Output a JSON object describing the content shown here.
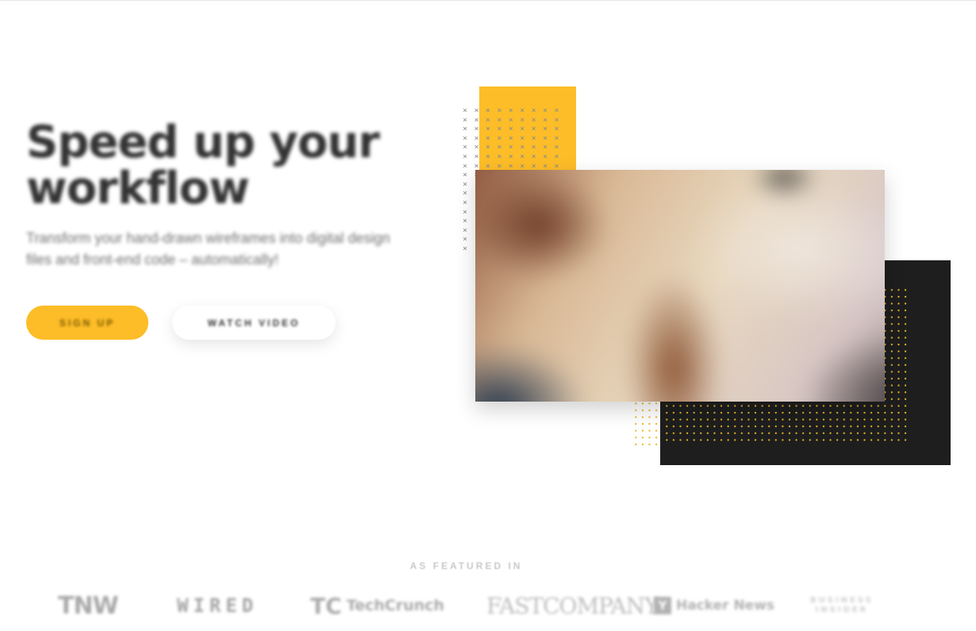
{
  "hero": {
    "headline": "Speed up your workflow",
    "subtitle": "Transform your hand-drawn wireframes into digital design files and front-end code – automatically!",
    "primary_cta": "SIGN UP",
    "secondary_cta": "WATCH VIDEO"
  },
  "featured": {
    "label": "AS FEATURED IN",
    "logos": {
      "tnw": "TNW",
      "wired": "WIRED",
      "techcrunch_mark": "TC",
      "techcrunch": "TechCrunch",
      "fastcompany": "FASTCOMPANY",
      "hackernews_mark": "Y",
      "hackernews": "Hacker News",
      "businessinsider_line1": "BUSINESS",
      "businessinsider_line2": "INSIDER"
    }
  },
  "colors": {
    "accent": "#fdbd28",
    "dark": "#1e1e1e",
    "text": "#333333"
  }
}
